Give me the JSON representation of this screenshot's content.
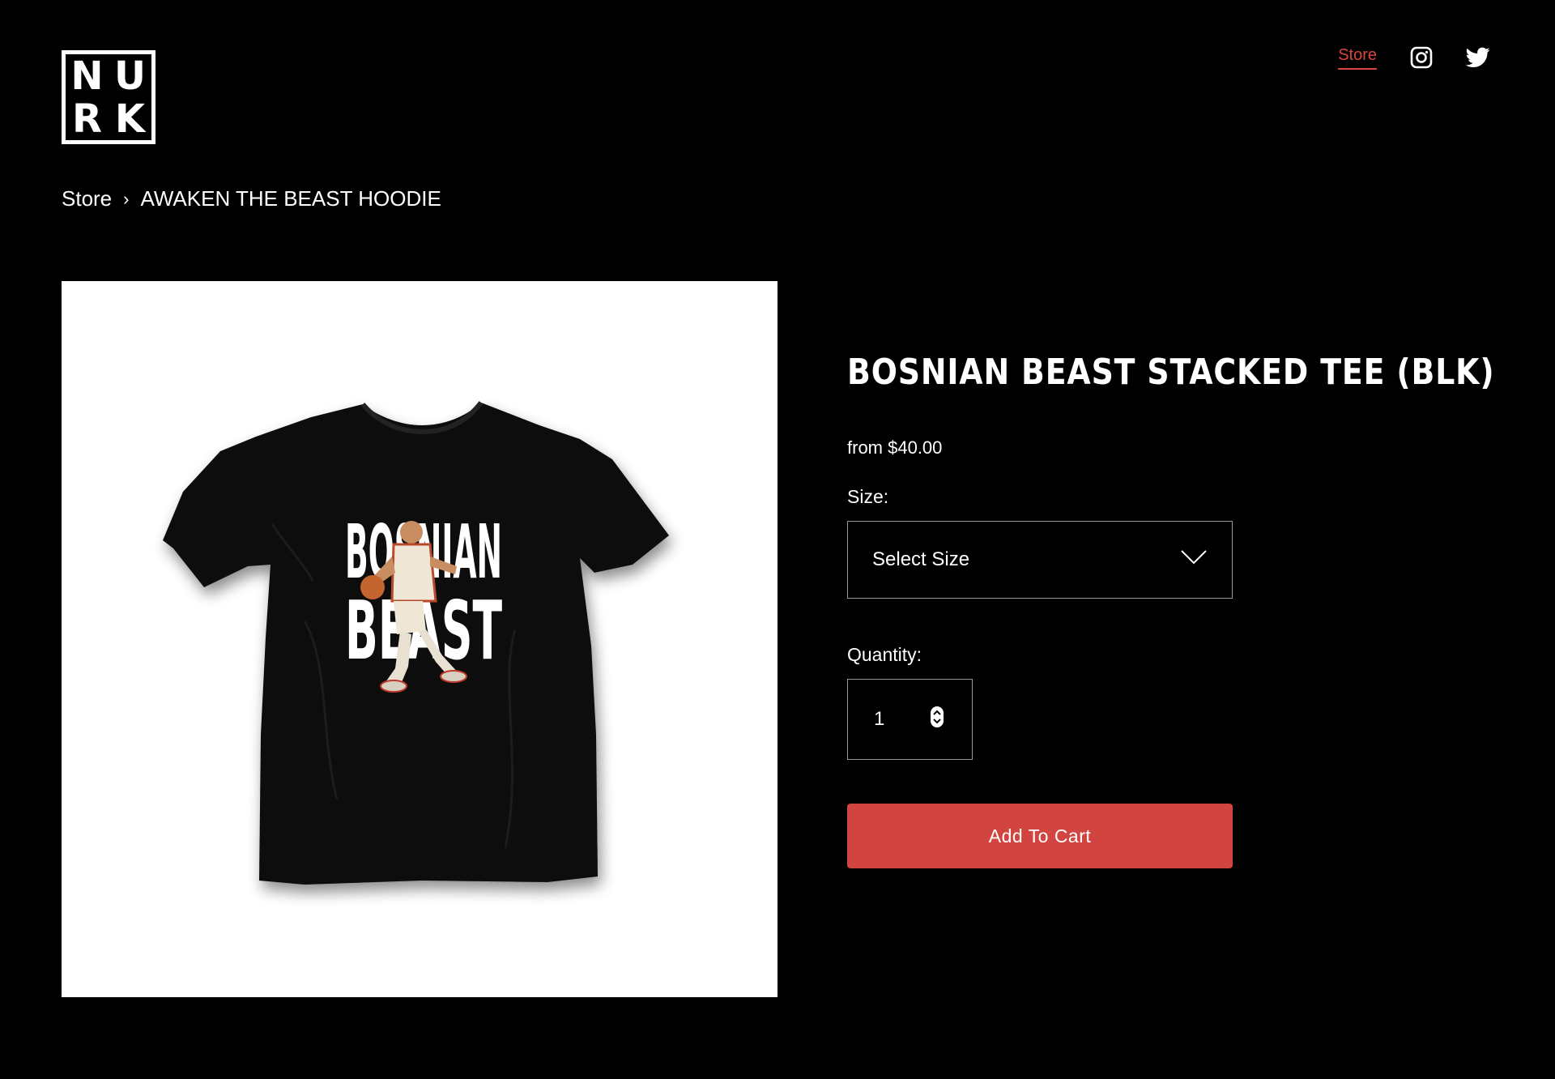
{
  "header": {
    "logo": {
      "row1": "NU",
      "row2": "RK"
    },
    "nav": {
      "store_label": "Store",
      "icons": [
        "instagram-icon",
        "twitter-icon"
      ]
    }
  },
  "breadcrumb": {
    "items": [
      "Store",
      "AWAKEN THE BEAST HOODIE"
    ],
    "separator": "›"
  },
  "product": {
    "title": "BOSNIAN BEAST STACKED TEE (BLK)",
    "price": "from $40.00",
    "image_print": {
      "line1": "BOSNIAN",
      "line2": "BEAST"
    },
    "size": {
      "label": "Size:",
      "selected": "Select Size"
    },
    "quantity": {
      "label": "Quantity:",
      "value": "1"
    },
    "add_to_cart_label": "Add To Cart"
  },
  "colors": {
    "background": "#000000",
    "accent": "#d2443f",
    "text": "#ffffff",
    "border": "#9a9a9a"
  }
}
